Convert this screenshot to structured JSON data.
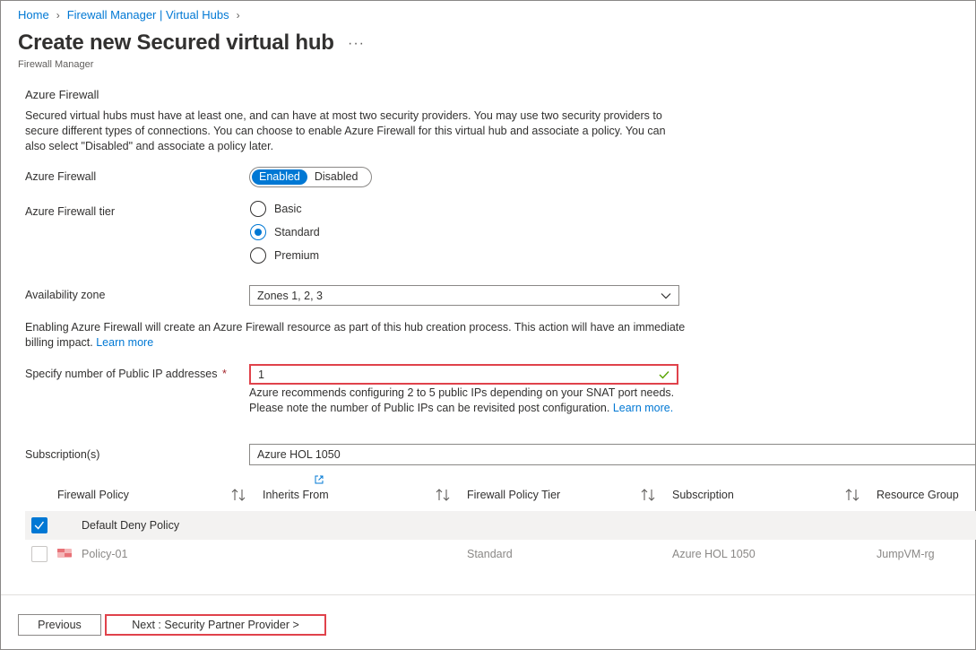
{
  "breadcrumb": {
    "home": "Home",
    "parent": "Firewall Manager | Virtual Hubs"
  },
  "header": {
    "title": "Create new Secured virtual hub",
    "more": "···",
    "subtitle": "Firewall Manager"
  },
  "azure_firewall_section": {
    "title": "Azure Firewall",
    "description": "Secured virtual hubs must have at least one, and can have at most two security providers. You may use two security providers to secure different types of connections. You can choose to enable Azure Firewall for this virtual hub and associate a policy. You can also select \"Disabled\" and associate a policy later."
  },
  "firewall_toggle": {
    "label": "Azure Firewall",
    "enabled": "Enabled",
    "disabled": "Disabled",
    "selected": "Enabled"
  },
  "tier": {
    "label": "Azure Firewall tier",
    "options": [
      "Basic",
      "Standard",
      "Premium"
    ],
    "selected": "Standard"
  },
  "availability_zone": {
    "label": "Availability zone",
    "value": "Zones 1, 2, 3"
  },
  "billing_notice": {
    "text": "Enabling Azure Firewall will create an Azure Firewall resource as part of this hub creation process. This action will have an immediate billing impact.",
    "link": "Learn more"
  },
  "public_ip": {
    "label": "Specify number of Public IP addresses",
    "required_mark": "*",
    "value": "1",
    "help": "Azure recommends configuring 2 to 5 public IPs depending on your SNAT port needs. Please note the number of Public IPs can be revisited post configuration.",
    "help_link": "Learn more."
  },
  "subscription": {
    "label": "Subscription(s)",
    "value": "Azure HOL 1050"
  },
  "policy_table": {
    "columns": [
      "Firewall Policy",
      "Inherits From",
      "Firewall Policy Tier",
      "Subscription",
      "Resource Group"
    ],
    "rows": [
      {
        "name": "Default Deny Policy",
        "inherits": "",
        "tier": "",
        "subscription": "",
        "resource_group": "",
        "checked": true,
        "disabled": false
      },
      {
        "name": "Policy-01",
        "inherits": "",
        "tier": "Standard",
        "subscription": "Azure HOL 1050",
        "resource_group": "JumpVM-rg",
        "checked": false,
        "disabled": true
      }
    ]
  },
  "footer": {
    "previous": "Previous",
    "next": "Next : Security Partner Provider >"
  },
  "colors": {
    "accent": "#0078d4",
    "error_outline": "#e0424b",
    "success": "#57a300"
  }
}
